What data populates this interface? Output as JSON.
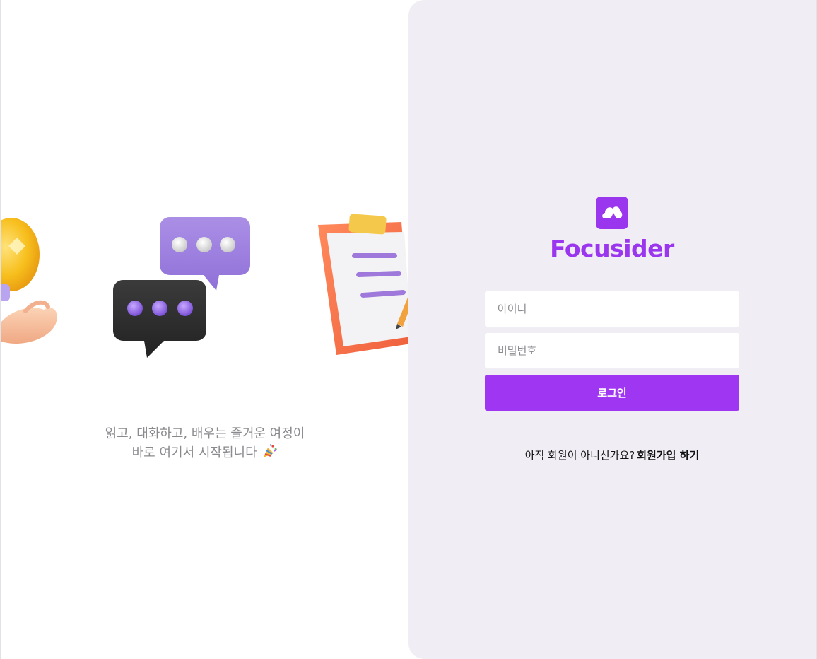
{
  "colors": {
    "brand": "#9b36ef",
    "button": "#9f36f2",
    "panel_bg": "#f0eef4",
    "tagline": "#8a8a8e"
  },
  "promo": {
    "illustrations": [
      "lightbulb-in-hand-icon",
      "chat-bubbles-icon",
      "clipboard-checklist-icon"
    ],
    "tagline_line1": "읽고, 대화하고, 배우는 즐거운 여정이",
    "tagline_line2": "바로 여기서 시작됩니다",
    "tagline_emoji": "party-popper-icon"
  },
  "brand": {
    "logo_icon": "cloud-logo-icon",
    "name": "Focusider"
  },
  "login": {
    "id_placeholder": "아이디",
    "password_placeholder": "비밀번호",
    "submit_label": "로그인"
  },
  "signup": {
    "prompt": "아직 회원이 아니신가요?",
    "link_label": "회원가입 하기"
  }
}
